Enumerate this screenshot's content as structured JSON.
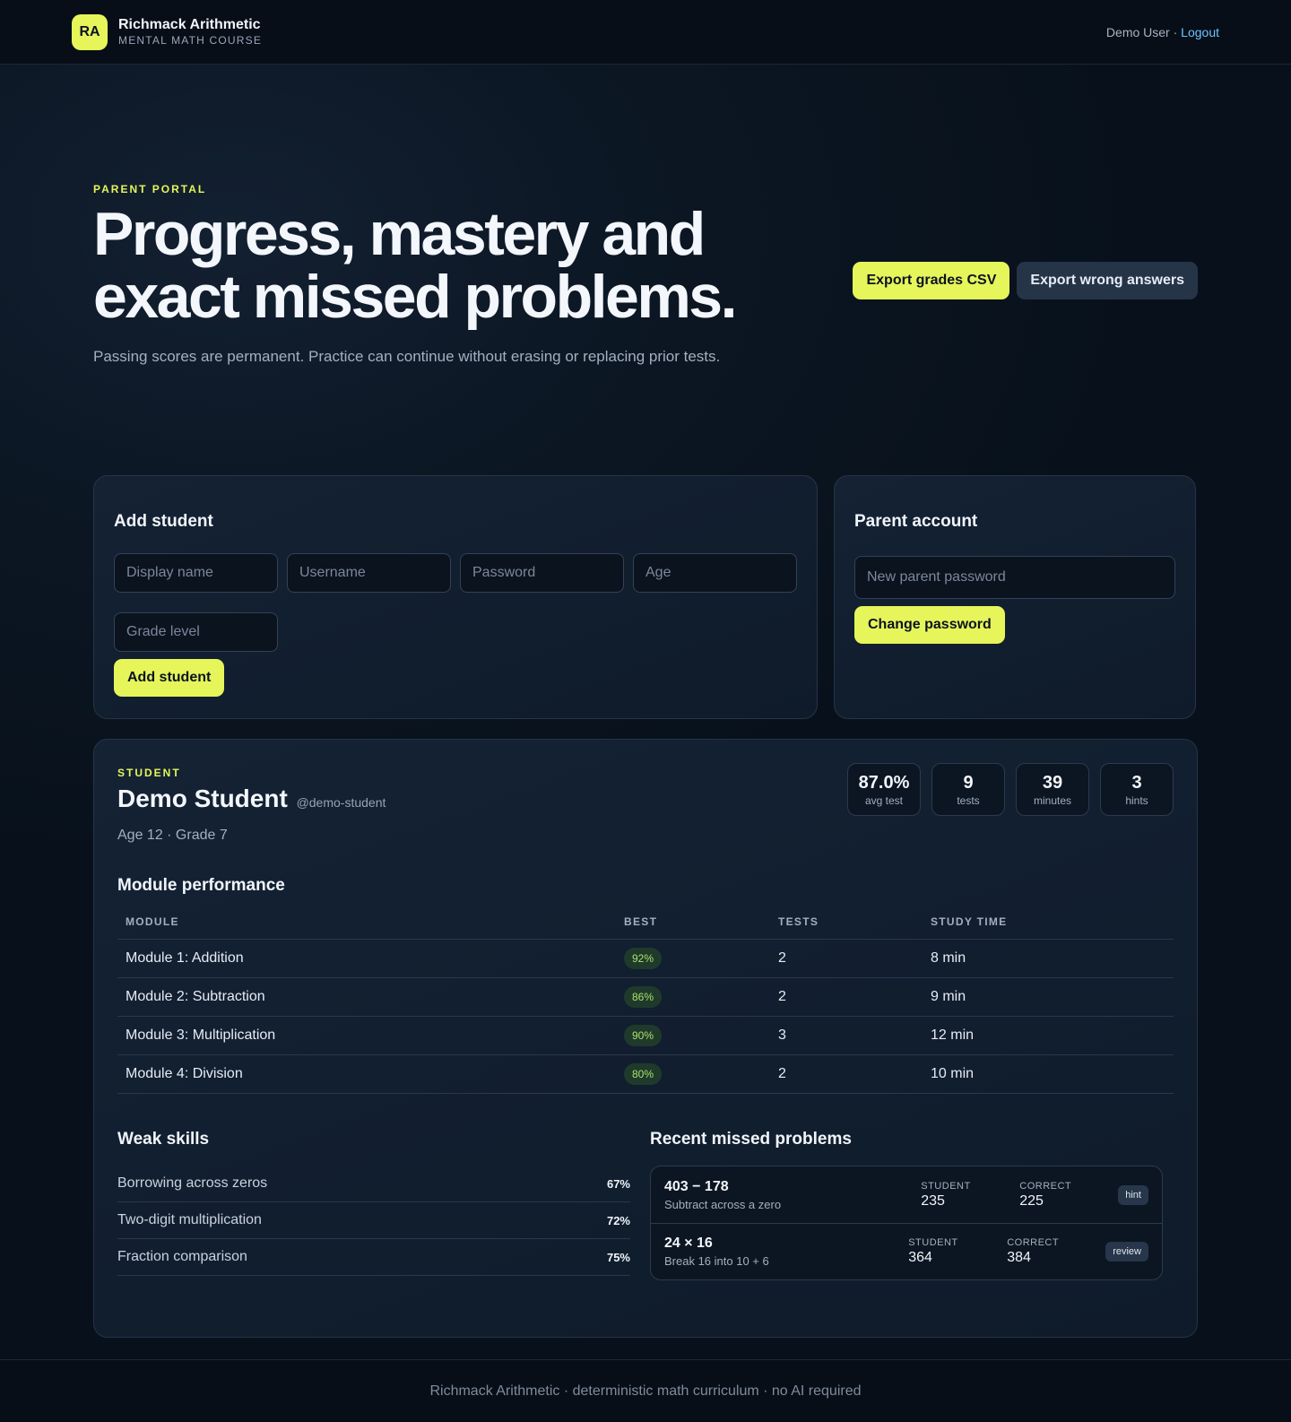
{
  "brand": {
    "logo": "RA",
    "title": "Richmack Arithmetic",
    "subtitle": "MENTAL MATH COURSE"
  },
  "user": {
    "name": "Demo User",
    "separator": "·",
    "logout": "Logout"
  },
  "hero": {
    "eyebrow": "PARENT PORTAL",
    "title": "Progress, mastery and exact missed problems.",
    "subtitle": "Passing scores are permanent. Practice can continue without erasing or replacing prior tests.",
    "export_grades": "Export grades CSV",
    "export_wrong": "Export wrong answers"
  },
  "add_student": {
    "title": "Add student",
    "fields": {
      "display_name": "Display name",
      "username": "Username",
      "password": "Password",
      "age": "Age",
      "grade_level": "Grade level"
    },
    "button": "Add student"
  },
  "parent_account": {
    "title": "Parent account",
    "password_placeholder": "New parent password",
    "button": "Change password"
  },
  "student": {
    "eyebrow": "STUDENT",
    "name": "Demo Student",
    "handle": "@demo-student",
    "meta": "Age 12 · Grade 7",
    "stats": [
      {
        "value": "87.0%",
        "label": "avg test"
      },
      {
        "value": "9",
        "label": "tests"
      },
      {
        "value": "39",
        "label": "minutes"
      },
      {
        "value": "3",
        "label": "hints"
      }
    ]
  },
  "modules": {
    "title": "Module performance",
    "columns": [
      "MODULE",
      "BEST",
      "TESTS",
      "STUDY TIME"
    ],
    "rows": [
      {
        "module": "Module 1: Addition",
        "best": "92%",
        "tests": "2",
        "time": "8 min"
      },
      {
        "module": "Module 2: Subtraction",
        "best": "86%",
        "tests": "2",
        "time": "9 min"
      },
      {
        "module": "Module 3: Multiplication",
        "best": "90%",
        "tests": "3",
        "time": "12 min"
      },
      {
        "module": "Module 4: Division",
        "best": "80%",
        "tests": "2",
        "time": "10 min"
      }
    ]
  },
  "weak_skills": {
    "title": "Weak skills",
    "items": [
      {
        "name": "Borrowing across zeros",
        "pct": "67%"
      },
      {
        "name": "Two-digit multiplication",
        "pct": "72%"
      },
      {
        "name": "Fraction comparison",
        "pct": "75%"
      }
    ]
  },
  "missed": {
    "title": "Recent missed problems",
    "student_label": "STUDENT",
    "correct_label": "CORRECT",
    "items": [
      {
        "problem": "403 − 178",
        "hint": "Subtract across a zero",
        "student": "235",
        "correct": "225",
        "tag": "hint"
      },
      {
        "problem": "24 × 16",
        "hint": "Break 16 into 10 + 6",
        "student": "364",
        "correct": "384",
        "tag": "review"
      }
    ]
  },
  "footer": "Richmack Arithmetic · deterministic math curriculum · no AI required"
}
